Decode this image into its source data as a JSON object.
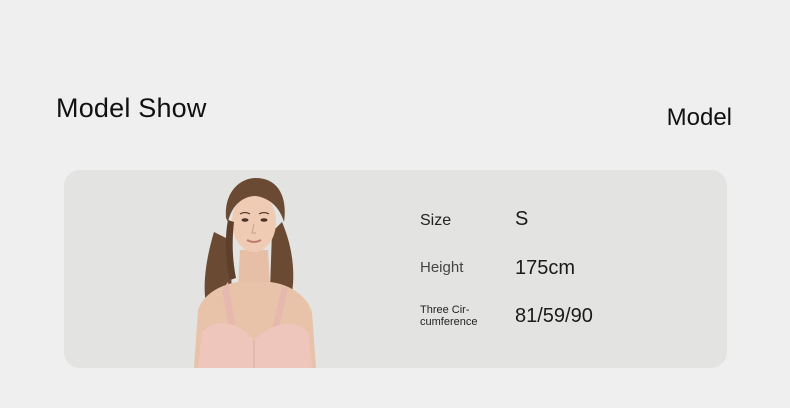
{
  "header": {
    "title": "Model Show",
    "right_label": "Model"
  },
  "card": {
    "rows": [
      {
        "key": "Size",
        "value": "S"
      },
      {
        "key": "Height",
        "value": "175cm"
      },
      {
        "key_line1": "Three Cir-",
        "key_line2": "cumference",
        "value": "81/59/90"
      }
    ]
  }
}
